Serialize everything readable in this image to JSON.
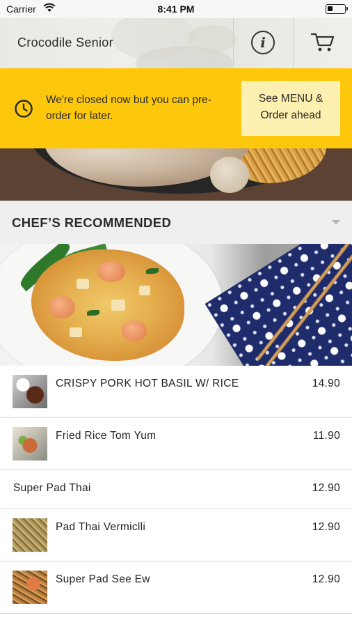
{
  "status_bar": {
    "carrier": "Carrier",
    "time": "8:41 PM"
  },
  "header": {
    "title": "Crocodile Senior",
    "info_glyph": "i",
    "icons": [
      "info-icon",
      "cart-icon"
    ]
  },
  "banner": {
    "message": "We're closed now but you can pre-order for later.",
    "button_label": "See MENU & Order ahead",
    "background_color": "#fdc80c",
    "button_color": "#fef0b0",
    "icon": "clock-icon"
  },
  "section": {
    "title": "CHEF’S RECOMMENDED",
    "expand_icon": "caret-down-icon"
  },
  "menu_items": [
    {
      "name": "CRISPY PORK HOT BASIL W/ RICE",
      "price": "14.90",
      "has_thumbnail": true
    },
    {
      "name": "Fried Rice Tom Yum",
      "price": "11.90",
      "has_thumbnail": true
    },
    {
      "name": "Super Pad Thai",
      "price": "12.90",
      "has_thumbnail": false
    },
    {
      "name": "Pad Thai Vermiclli",
      "price": "12.90",
      "has_thumbnail": true
    },
    {
      "name": "Super Pad See Ew",
      "price": "12.90",
      "has_thumbnail": true
    }
  ]
}
